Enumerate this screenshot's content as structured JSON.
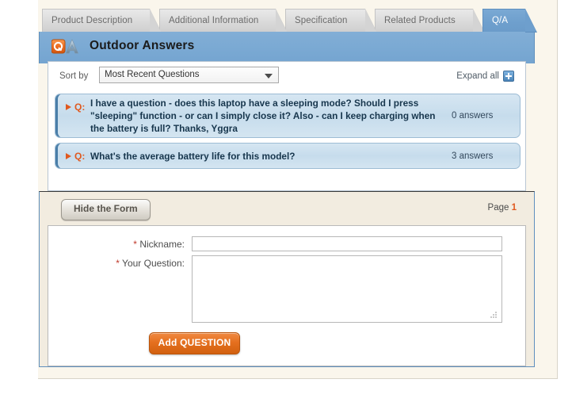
{
  "tabs": [
    {
      "label": "Product Description",
      "active": false
    },
    {
      "label": "Additional Information",
      "active": false
    },
    {
      "label": "Specification",
      "active": false
    },
    {
      "label": "Related Products",
      "active": false
    },
    {
      "label": "Q/A",
      "active": true
    }
  ],
  "header": {
    "brand_title": "Outdoor Answers",
    "logo_q": "Q",
    "logo_a": "A"
  },
  "toolbar": {
    "sort_label": "Sort by",
    "sort_value": "Most Recent Questions",
    "sort_options": [
      "Most Recent Questions"
    ],
    "expand_all_label": "Expand all"
  },
  "questions": [
    {
      "marker": "Q:",
      "text": "I have a question - does this laptop have a sleeping mode? Should I press \"sleeping\" function - or can I simply close it? Also - can I keep charging when the battery is full? Thanks, Yggra",
      "answers": "0 answers"
    },
    {
      "marker": "Q:",
      "text": "What's the average battery life for this model?",
      "answers": "3 answers"
    }
  ],
  "form_strip": {
    "hide_form_label": "Hide the Form",
    "page_label": "Page",
    "page_number": "1"
  },
  "form": {
    "nickname_label": "Nickname:",
    "nickname_value": "",
    "nickname_placeholder": "",
    "question_label": "Your Question:",
    "question_value": "",
    "question_placeholder": "",
    "required_mark": "*",
    "submit_label": "Add QUESTION"
  },
  "colors": {
    "accent_blue": "#74a4d0",
    "accent_orange": "#e0591f",
    "panel_beige": "#f2ece0",
    "question_bg": "#c6dcec",
    "required_red": "#c0392b"
  }
}
